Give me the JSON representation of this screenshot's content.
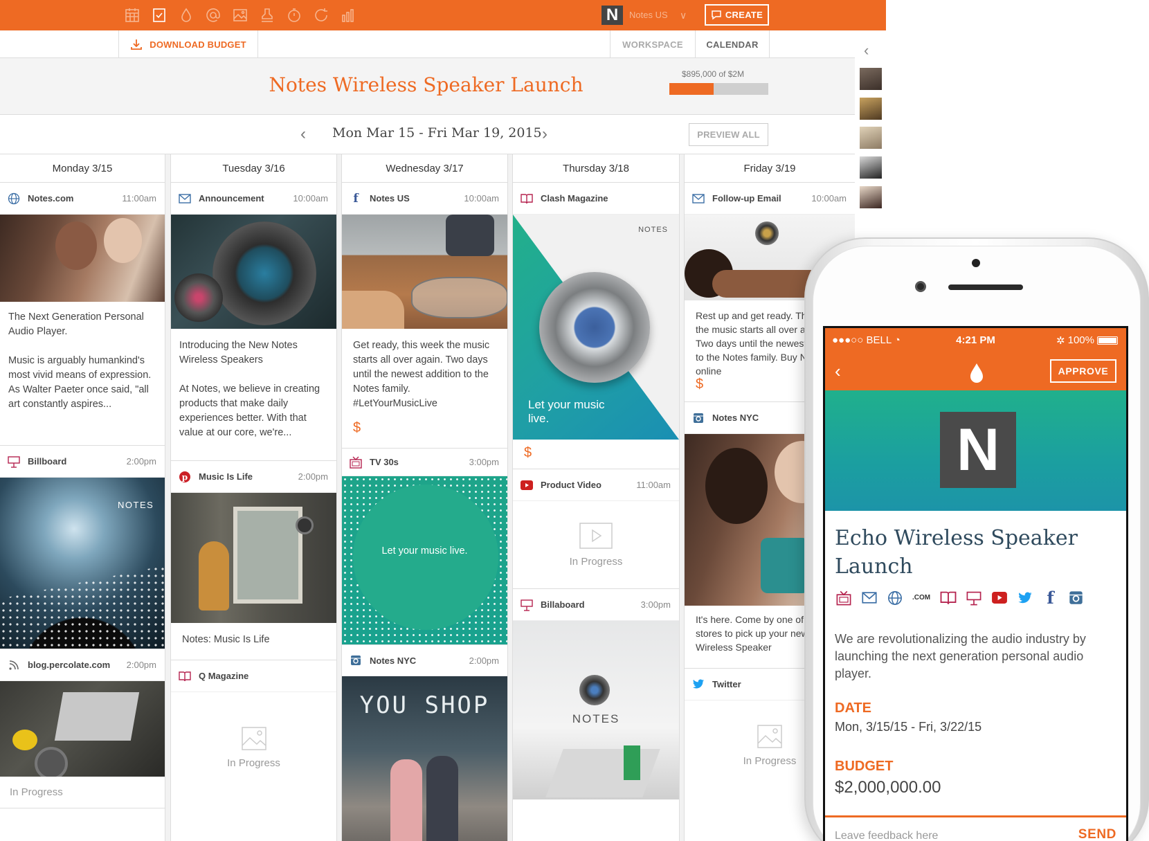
{
  "topbar": {
    "icons": [
      "calendar-icon",
      "checklist-icon",
      "drop-icon",
      "mention-icon",
      "image-icon",
      "stamp-icon",
      "timer-icon",
      "refresh-icon",
      "bar-chart-icon"
    ],
    "brand_logo_letter": "N",
    "brand_name": "Notes US",
    "create_label": "CREATE",
    "accent": "#ee6a23"
  },
  "subbar": {
    "download_label": "DOWNLOAD BUDGET",
    "tabs": [
      "WORKSPACE",
      "CALENDAR"
    ]
  },
  "project": {
    "title": "Notes Wireless Speaker Launch",
    "budget_text": "$895,000 of $2M",
    "budget_fraction": 0.4475
  },
  "datenav": {
    "range": "Mon Mar 15 - Fri Mar 19, 2015",
    "preview_label": "PREVIEW ALL"
  },
  "columns": [
    {
      "day": "Monday 3/15",
      "cards": [
        {
          "icon": "globe-icon",
          "name": "Notes.com",
          "time": "11:00am",
          "text": "The Next Generation Personal Audio Player.\n\nMusic is arguably humankind's most vivid means of expression. As Walter Paeter once said, \"all art constantly aspires..."
        },
        {
          "icon": "billboard-icon",
          "name": "Billboard",
          "time": "2:00pm",
          "overlay": "NOTES"
        },
        {
          "icon": "rss-icon",
          "name": "blog.percolate.com",
          "time": "2:00pm",
          "status": "In Progress"
        }
      ]
    },
    {
      "day": "Tuesday 3/16",
      "cards": [
        {
          "icon": "mail-icon",
          "name": "Announcement",
          "time": "10:00am",
          "text": "Introducing the New Notes Wireless Speakers\n\nAt Notes, we believe in creating products that make daily experiences better. With that value at our core, we're..."
        },
        {
          "icon": "pinterest-icon",
          "name": "Music Is Life",
          "time": "2:00pm",
          "text": "Notes: Music Is Life"
        },
        {
          "icon": "book-icon",
          "name": "Q Magazine",
          "time": "",
          "status": "In Progress"
        }
      ]
    },
    {
      "day": "Wednesday 3/17",
      "cards": [
        {
          "icon": "facebook-icon",
          "name": "Notes US",
          "time": "10:00am",
          "text": "Get ready, this week the music starts all over again. Two days until the newest addition to the Notes family. #LetYourMusicLive",
          "dollar": "$"
        },
        {
          "icon": "tv-icon",
          "name": "TV 30s",
          "time": "3:00pm",
          "overlay": "Let your music live."
        },
        {
          "icon": "instagram-icon",
          "name": "Notes NYC",
          "time": "2:00pm",
          "overlay": "YOU SHOP"
        }
      ]
    },
    {
      "day": "Thursday 3/18",
      "cards": [
        {
          "icon": "book-icon",
          "name": "Clash Magazine",
          "time": "",
          "overlay": "Let your music live.",
          "brand": "NOTES",
          "dollar": "$"
        },
        {
          "icon": "youtube-icon",
          "name": "Product Video",
          "time": "11:00am",
          "status": "In Progress"
        },
        {
          "icon": "billboard-icon",
          "name": "Billaboard",
          "time": "3:00pm",
          "brand": "NOTES"
        }
      ]
    },
    {
      "day": "Friday 3/19",
      "cards": [
        {
          "icon": "mail-icon",
          "name": "Follow-up Email",
          "time": "10:00am",
          "text": "Rest up and get ready. This week, the music starts all over again. Two days until the newest addition to the Notes family. Buy Notes online",
          "dollar": "$"
        },
        {
          "icon": "instagram-icon",
          "name": "Notes NYC",
          "time": "",
          "text": "It's here. Come by one of our stores to pick up your new Notes Wireless Speaker"
        },
        {
          "icon": "twitter-icon",
          "name": "Twitter",
          "time": "",
          "status": "In Progress"
        }
      ]
    }
  ],
  "phone": {
    "status": {
      "carrier": "●●●○○ BELL",
      "time": "4:21 PM",
      "battery": "100%"
    },
    "approve_label": "APPROVE",
    "logo_letter": "N",
    "title": "Echo Wireless Speaker Launch",
    "channel_icons": [
      "tv-icon",
      "mail-icon",
      "globe-icon",
      "dotcom-icon",
      "book-icon",
      "billboard-icon",
      "youtube-icon",
      "twitter-icon",
      "facebook-icon",
      "instagram-icon"
    ],
    "dotcom_label": ".COM",
    "description": "We are revolutionalizing the audio industry by launching the next generation personal audio player.",
    "date_label": "DATE",
    "date_value": "Mon, 3/15/15 - Fri, 3/22/15",
    "budget_label": "BUDGET",
    "budget_value": "$2,000,000.00",
    "feedback_placeholder": "Leave feedback here",
    "send_label": "SEND"
  }
}
